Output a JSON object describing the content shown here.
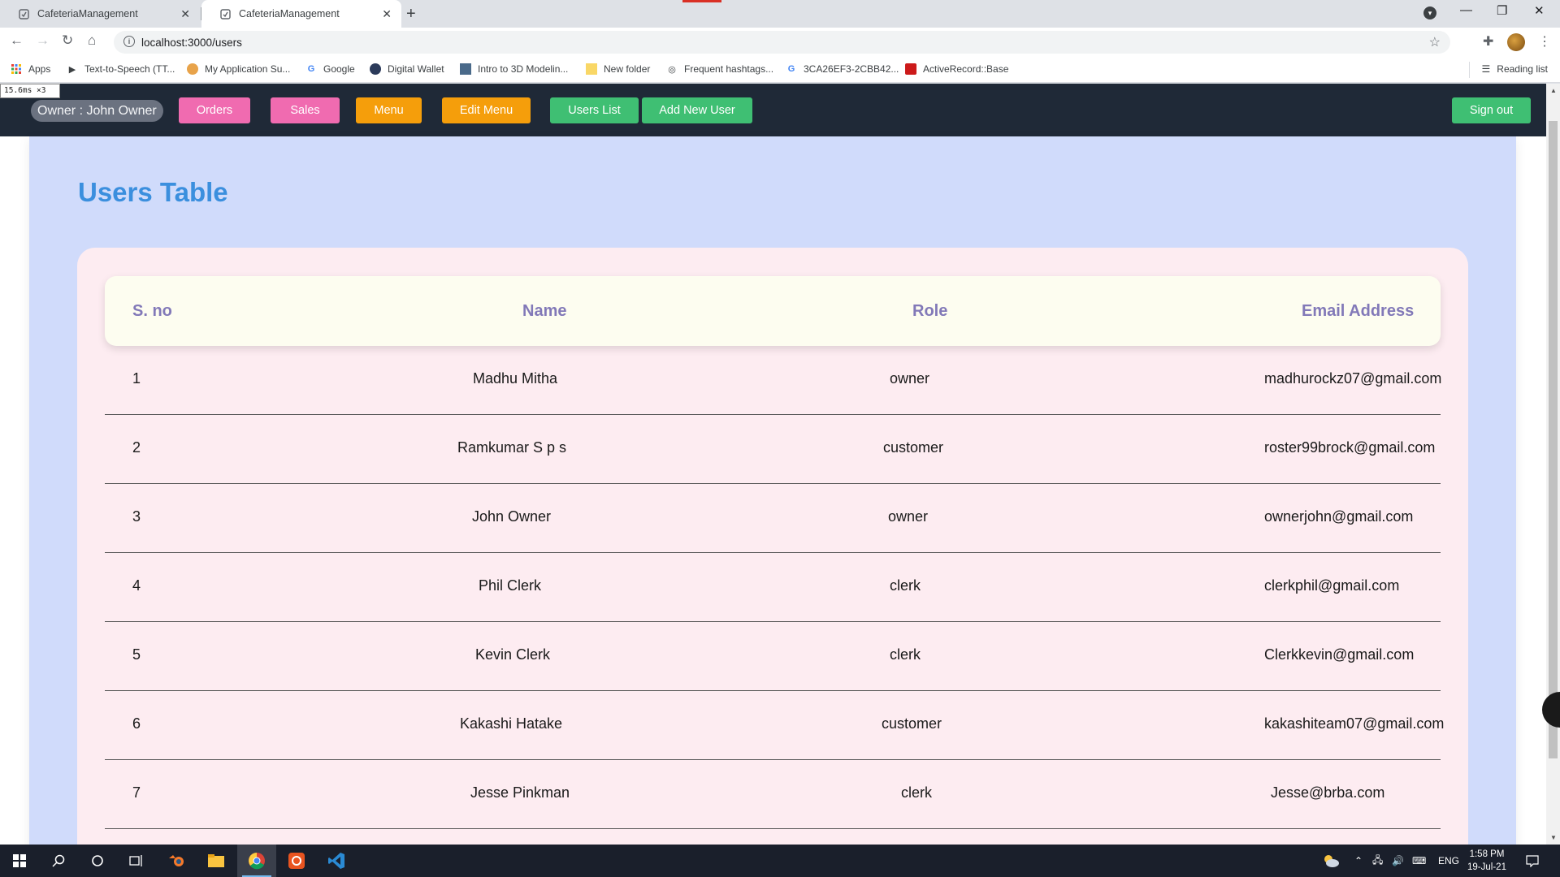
{
  "browser": {
    "tabs": [
      {
        "title": "CafeteriaManagement",
        "active": false
      },
      {
        "title": "CafeteriaManagement",
        "active": true
      }
    ],
    "url": "localhost:3000/users",
    "bookmarks": [
      {
        "label": "Apps",
        "icon": "apps-grid-icon"
      },
      {
        "label": "Text-to-Speech (TT...",
        "icon": "tts-icon"
      },
      {
        "label": "My Application Su...",
        "icon": "application-icon"
      },
      {
        "label": "Google",
        "icon": "google-icon"
      },
      {
        "label": "Digital Wallet",
        "icon": "wallet-icon"
      },
      {
        "label": "Intro to 3D Modelin...",
        "icon": "modeling-icon"
      },
      {
        "label": "New folder",
        "icon": "folder-icon"
      },
      {
        "label": "Frequent hashtags...",
        "icon": "hashtag-icon"
      },
      {
        "label": "3CA26EF3-2CBB42...",
        "icon": "google-icon"
      },
      {
        "label": "ActiveRecord::Base",
        "icon": "ruby-icon"
      }
    ],
    "reading_list": "Reading list"
  },
  "perf_meter": "15.6ms ×3",
  "nav": {
    "owner": "Owner : John Owner",
    "orders": "Orders",
    "sales": "Sales",
    "menu": "Menu",
    "edit_menu": "Edit Menu",
    "users_list": "Users List",
    "add_new_user": "Add New User",
    "sign_out": "Sign out"
  },
  "page": {
    "title": "Users Table",
    "columns": {
      "sno": "S. no",
      "name": "Name",
      "role": "Role",
      "email": "Email Address"
    },
    "rows": [
      {
        "sno": "1",
        "name": "Madhu Mitha",
        "role": "owner",
        "email": "madhurockz07@gmail.com"
      },
      {
        "sno": "2",
        "name": "Ramkumar S p s",
        "role": "customer",
        "email": "roster99brock@gmail.com"
      },
      {
        "sno": "3",
        "name": "John Owner",
        "role": "owner",
        "email": "ownerjohn@gmail.com"
      },
      {
        "sno": "4",
        "name": "Phil Clerk",
        "role": "clerk",
        "email": "clerkphil@gmail.com"
      },
      {
        "sno": "5",
        "name": "Kevin Clerk",
        "role": "clerk",
        "email": "Clerkkevin@gmail.com"
      },
      {
        "sno": "6",
        "name": "Kakashi Hatake",
        "role": "customer",
        "email": "kakashiteam07@gmail.com"
      },
      {
        "sno": "7",
        "name": "Jesse Pinkman",
        "role": "clerk",
        "email": "Jesse@brba.com"
      }
    ]
  },
  "taskbar": {
    "language": "ENG",
    "time": "1:58 PM",
    "date": "19-Jul-21"
  },
  "colors": {
    "nav_bg": "#1f2937",
    "pink_button": "#f06bb0",
    "orange_button": "#f59e0b",
    "green_button": "#3fbf73",
    "title": "#3b8fde",
    "container_bg": "#d0dbfb",
    "card_bg": "#fdecf1",
    "header_text": "#8279b8"
  }
}
